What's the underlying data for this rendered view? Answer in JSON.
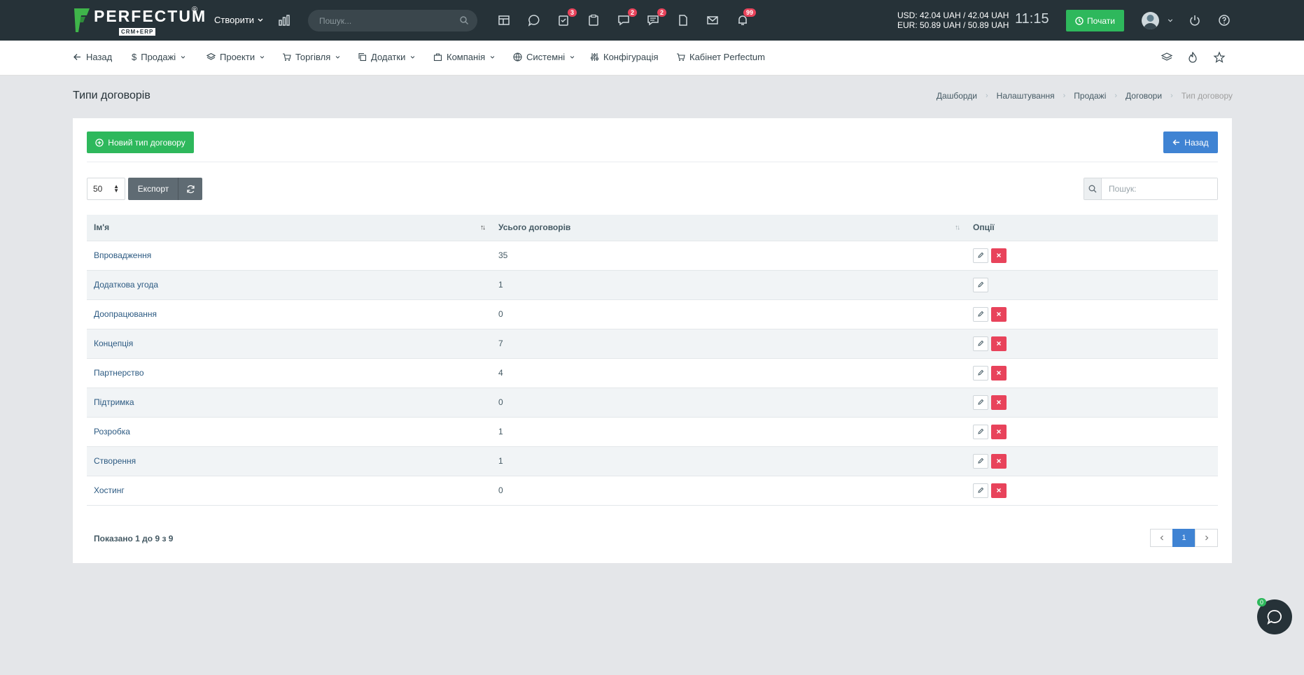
{
  "header": {
    "logo_title": "PERFECTUM",
    "logo_reg": "®",
    "logo_sub": "CRM+ERP",
    "create_label": "Створити",
    "search_placeholder": "Пошук...",
    "badges": {
      "tasks": "3",
      "projects_chat": "2",
      "discussions": "2",
      "notifications": "99"
    },
    "rates_usd": "USD: 42.04 UAH / 42.04 UAH",
    "rates_eur": "EUR: 50.89 UAH / 50.89 UAH",
    "clock": "11:15",
    "start_label": "Почати"
  },
  "nav": {
    "back": "Назад",
    "sales": "Продажі",
    "projects": "Проекти",
    "trade": "Торгівля",
    "addons": "Додатки",
    "company": "Компанія",
    "system": "Системні",
    "config": "Конфігурація",
    "cabinet": "Кабінет Perfectum"
  },
  "page": {
    "title": "Типи договорів",
    "breadcrumb": [
      "Дашборди",
      "Налаштування",
      "Продажі",
      "Договори",
      "Тип договору"
    ]
  },
  "card": {
    "new_button": "Новий тип договору",
    "back_button": "Назад",
    "per_page": "50",
    "export_label": "Експорт",
    "search_placeholder": "Пошук:"
  },
  "table": {
    "columns": [
      "Ім'я",
      "Усього договорів",
      "Опції"
    ],
    "rows": [
      {
        "name": "Впровадження",
        "total": "35",
        "deletable": true
      },
      {
        "name": "Додаткова угода",
        "total": "1",
        "deletable": false
      },
      {
        "name": "Доопрацювання",
        "total": "0",
        "deletable": true
      },
      {
        "name": "Концепція",
        "total": "7",
        "deletable": true
      },
      {
        "name": "Партнерство",
        "total": "4",
        "deletable": true
      },
      {
        "name": "Підтримка",
        "total": "0",
        "deletable": true
      },
      {
        "name": "Розробка",
        "total": "1",
        "deletable": true
      },
      {
        "name": "Створення",
        "total": "1",
        "deletable": true
      },
      {
        "name": "Хостинг",
        "total": "0",
        "deletable": true
      }
    ]
  },
  "footer": {
    "showing": "Показано 1 до 9 з 9",
    "current_page": "1"
  },
  "chat": {
    "badge": "0"
  },
  "colors": {
    "header_bg": "#263238",
    "success": "#2eb85c",
    "primary": "#3f83d3",
    "danger": "#e8435b"
  }
}
